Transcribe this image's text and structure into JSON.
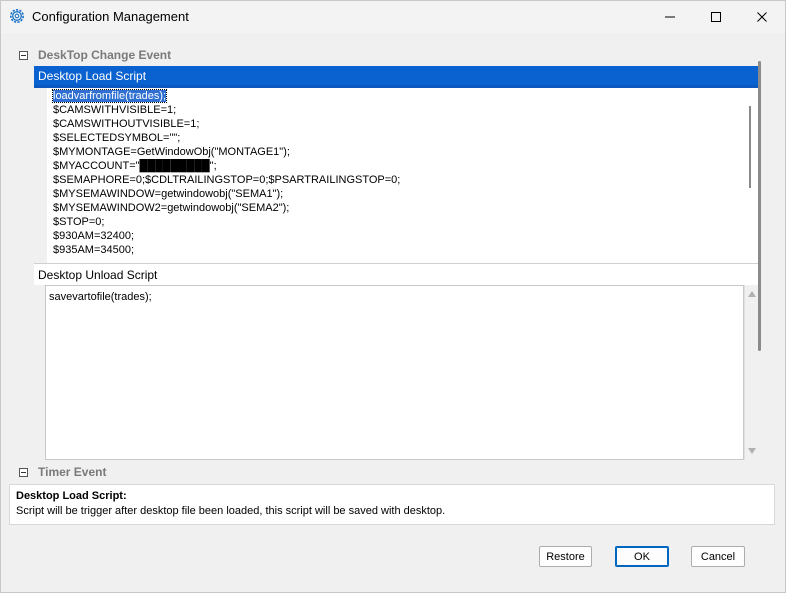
{
  "window": {
    "title": "Configuration Management"
  },
  "tree": {
    "groups": [
      {
        "title": "DeskTop Change Event"
      },
      {
        "title": "Timer Event"
      }
    ],
    "load_script": {
      "header": "Desktop Load Script",
      "lines": [
        "loadvarfromfile(trades);",
        "$CAMSWITHVISIBLE=1;",
        "$CAMSWITHOUTVISIBLE=1;",
        "$SELECTEDSYMBOL=\"\";",
        "$MYMONTAGE=GetWindowObj(\"MONTAGE1\");",
        "$MYACCOUNT=\"█████████\";",
        "$SEMAPHORE=0;$CDLTRAILINGSTOP=0;$PSARTRAILINGSTOP=0;",
        "$MYSEMAWINDOW=getwindowobj(\"SEMA1\");",
        "$MYSEMAWINDOW2=getwindowobj(\"SEMA2\");",
        "$STOP=0;",
        "$930AM=32400;",
        "$935AM=34500;"
      ]
    },
    "unload_script": {
      "header": "Desktop Unload Script",
      "lines": [
        "savevartofile(trades);"
      ]
    }
  },
  "description": {
    "title": "Desktop Load Script:",
    "text": "Script will be trigger after desktop file been loaded,  this script will be saved with desktop."
  },
  "buttons": {
    "restore": "Restore",
    "ok": "OK",
    "cancel": "Cancel"
  }
}
